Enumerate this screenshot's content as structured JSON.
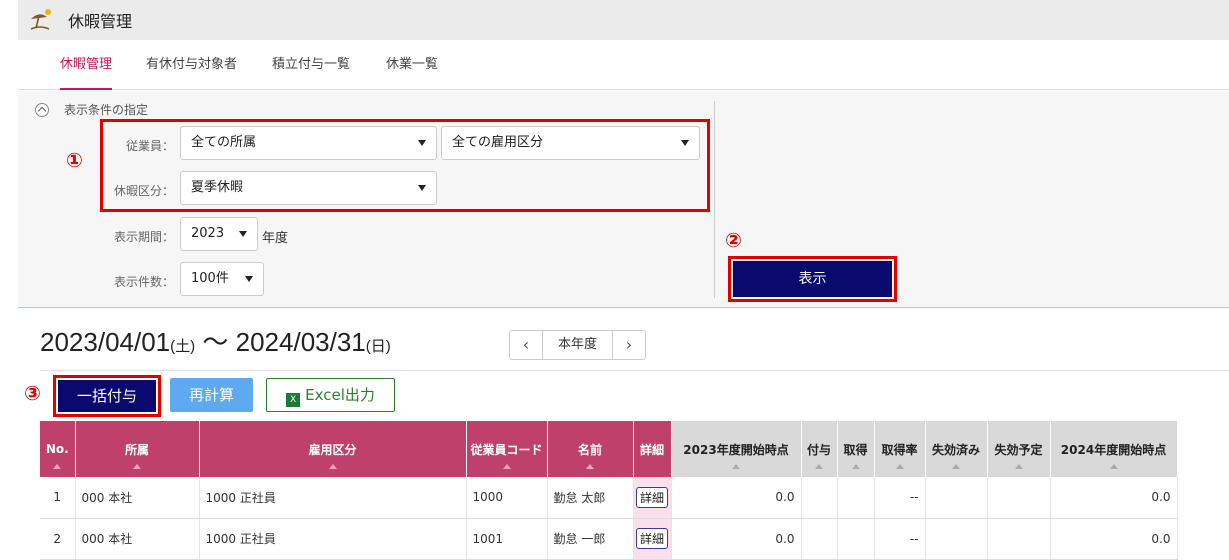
{
  "app": {
    "title": "休暇管理",
    "icon": "beach-umbrella-icon"
  },
  "tabs": [
    {
      "label": "休暇管理",
      "active": true
    },
    {
      "label": "有休付与対象者",
      "active": false
    },
    {
      "label": "積立付与一覧",
      "active": false
    },
    {
      "label": "休業一覧",
      "active": false
    }
  ],
  "filter": {
    "title": "表示条件の指定",
    "employee_label": "従業員：",
    "dept_value": "全ての所属",
    "emp_type_value": "全ての雇用区分",
    "leave_type_label": "休暇区分：",
    "leave_type_value": "夏季休暇",
    "period_label": "表示期間：",
    "year_value": "2023",
    "year_suffix": "年度",
    "count_label": "表示件数：",
    "count_value": "100件",
    "show_button": "表示"
  },
  "annotations": {
    "one": "①",
    "two": "②",
    "three": "③"
  },
  "period": {
    "start": "2023/04/01",
    "start_dow": "(土)",
    "tilde": "～",
    "end": "2024/03/31",
    "end_dow": "(日)",
    "prev": "‹",
    "current": "本年度",
    "next": "›"
  },
  "toolbar": {
    "bulk_grant": "一括付与",
    "recalc": "再計算",
    "excel_icon": "excel-icon",
    "excel": "Excel出力"
  },
  "table": {
    "headers": [
      "No.",
      "所属",
      "雇用区分",
      "従業員コード",
      "名前",
      "詳細",
      "2023年度開始時点",
      "付与",
      "取得",
      "取得率",
      "失効済み",
      "失効予定",
      "2024年度開始時点"
    ],
    "rows": [
      {
        "no": "1",
        "dept": "000 本社",
        "emp_type": "1000 正社員",
        "code": "1000",
        "name": "勤怠 太郎",
        "detail": "詳細",
        "start": "0.0",
        "grant": "",
        "taken": "",
        "rate": "--",
        "expired": "",
        "to_expire": "",
        "next_start": "0.0"
      },
      {
        "no": "2",
        "dept": "000 本社",
        "emp_type": "1000 正社員",
        "code": "1001",
        "name": "勤怠 一郎",
        "detail": "詳細",
        "start": "0.0",
        "grant": "",
        "taken": "",
        "rate": "--",
        "expired": "",
        "to_expire": "",
        "next_start": "0.0"
      }
    ]
  },
  "colors": {
    "accent": "#c2185b",
    "header": "#c0406c",
    "primary": "#0a0a6e",
    "annotation": "#e00000",
    "recalc": "#5ea9f0"
  }
}
